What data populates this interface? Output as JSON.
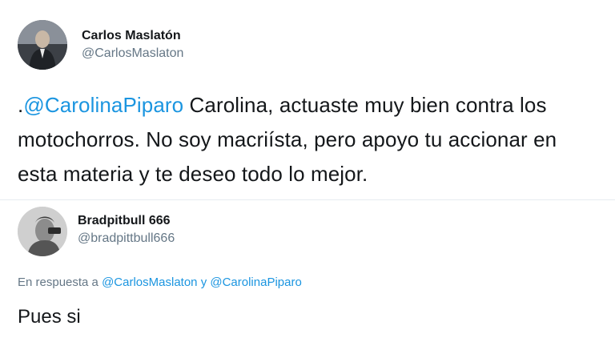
{
  "tweet": {
    "author": {
      "display_name": "Carlos Maslatón",
      "handle": "@CarlosMaslaton",
      "avatar_icon": "profile-photo-icon"
    },
    "text_prefix": ".",
    "mention": "@CarolinaPiparo",
    "text_body": " Carolina, actuaste muy bien contra los motochorros. No soy macriísta, pero apoyo tu accionar en esta materia y te deseo todo lo mejor."
  },
  "reply": {
    "author": {
      "display_name": "Bradpitbull 666",
      "handle": "@bradpittbull666",
      "avatar_icon": "profile-photo-icon"
    },
    "context_prefix": "En respuesta a",
    "context_mention_1": "@CarlosMaslaton",
    "context_joiner": "y",
    "context_mention_2": "@CarolinaPiparo",
    "text": "Pues si"
  },
  "colors": {
    "link": "#1b95e0",
    "secondary_text": "#657786",
    "primary_text": "#14171a",
    "divider": "#e6ecf0"
  }
}
